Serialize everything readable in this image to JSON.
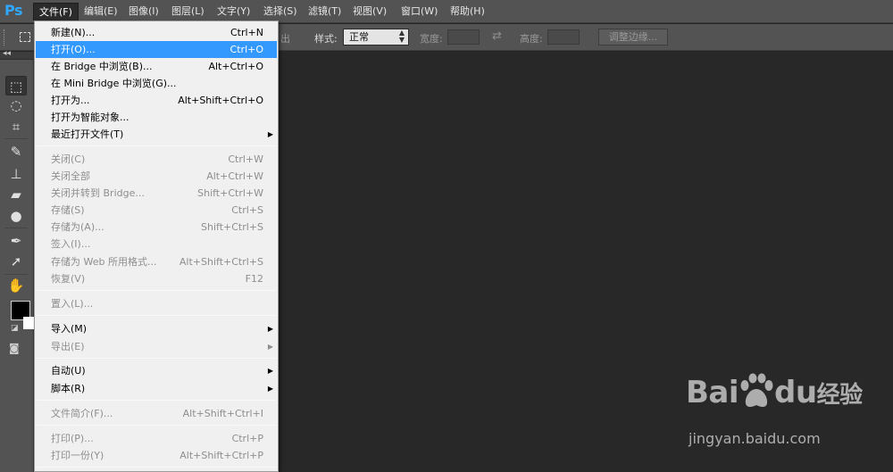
{
  "app": {
    "logo": "Ps"
  },
  "menubar": {
    "items": [
      {
        "label": "文件(F)",
        "active": true
      },
      {
        "label": "编辑(E)"
      },
      {
        "label": "图像(I)"
      },
      {
        "label": "图层(L)"
      },
      {
        "label": "文字(Y)"
      },
      {
        "label": "选择(S)"
      },
      {
        "label": "滤镜(T)"
      },
      {
        "label": "视图(V)"
      },
      {
        "label": "窗口(W)"
      },
      {
        "label": "帮助(H)"
      }
    ]
  },
  "options": {
    "partial_label": "出",
    "style_label": "样式:",
    "style_value": "正常",
    "width_label": "宽度:",
    "height_label": "高度:",
    "refine_edge_label": "调整边缘..."
  },
  "file_menu": {
    "items": [
      {
        "label": "新建(N)...",
        "shortcut": "Ctrl+N"
      },
      {
        "label": "打开(O)...",
        "shortcut": "Ctrl+O",
        "highlighted": true
      },
      {
        "label": "在 Bridge 中浏览(B)...",
        "shortcut": "Alt+Ctrl+O"
      },
      {
        "label": "在 Mini Bridge 中浏览(G)...",
        "shortcut": ""
      },
      {
        "label": "打开为...",
        "shortcut": "Alt+Shift+Ctrl+O"
      },
      {
        "label": "打开为智能对象...",
        "shortcut": ""
      },
      {
        "label": "最近打开文件(T)",
        "shortcut": "",
        "submenu": true
      },
      {
        "label": "关闭(C)",
        "shortcut": "Ctrl+W",
        "disabled": true
      },
      {
        "label": "关闭全部",
        "shortcut": "Alt+Ctrl+W",
        "disabled": true
      },
      {
        "label": "关闭并转到 Bridge...",
        "shortcut": "Shift+Ctrl+W",
        "disabled": true
      },
      {
        "label": "存储(S)",
        "shortcut": "Ctrl+S",
        "disabled": true
      },
      {
        "label": "存储为(A)...",
        "shortcut": "Shift+Ctrl+S",
        "disabled": true
      },
      {
        "label": "签入(I)...",
        "shortcut": "",
        "disabled": true
      },
      {
        "label": "存储为 Web 所用格式...",
        "shortcut": "Alt+Shift+Ctrl+S",
        "disabled": true
      },
      {
        "label": "恢复(V)",
        "shortcut": "F12",
        "disabled": true
      },
      {
        "label": "置入(L)...",
        "shortcut": "",
        "disabled": true
      },
      {
        "label": "导入(M)",
        "shortcut": "",
        "submenu": true
      },
      {
        "label": "导出(E)",
        "shortcut": "",
        "submenu": true,
        "disabled": true
      },
      {
        "label": "自动(U)",
        "shortcut": "",
        "submenu": true
      },
      {
        "label": "脚本(R)",
        "shortcut": "",
        "submenu": true
      },
      {
        "label": "文件简介(F)...",
        "shortcut": "Alt+Shift+Ctrl+I",
        "disabled": true
      },
      {
        "label": "打印(P)...",
        "shortcut": "Ctrl+P",
        "disabled": true
      },
      {
        "label": "打印一份(Y)",
        "shortcut": "Alt+Shift+Ctrl+P",
        "disabled": true
      }
    ],
    "submenu_arrow": "▶"
  },
  "tools": [
    {
      "name": "rectangular-marquee-tool-icon",
      "glyph": "⬚"
    },
    {
      "name": "lasso-tool-icon",
      "glyph": "◌"
    },
    {
      "name": "crop-tool-icon",
      "glyph": "⌗"
    },
    {
      "name": "spot-healing-brush-icon",
      "glyph": "✎"
    },
    {
      "name": "clone-stamp-icon",
      "glyph": "⊥"
    },
    {
      "name": "eraser-tool-icon",
      "glyph": "▰"
    },
    {
      "name": "blur-tool-icon",
      "glyph": "●"
    },
    {
      "name": "pen-tool-icon",
      "glyph": "✒"
    },
    {
      "name": "path-selection-icon",
      "glyph": "➚"
    },
    {
      "name": "hand-tool-icon",
      "glyph": "✋"
    }
  ],
  "watermark": {
    "text": "Bai",
    "text2": "du",
    "text3": "经验",
    "url": "jingyan.baidu.com"
  },
  "colors": {
    "accent": "#3399ff",
    "menubar_bg": "#535353",
    "canvas_bg": "#282828",
    "menu_bg": "#f0f0f0"
  }
}
